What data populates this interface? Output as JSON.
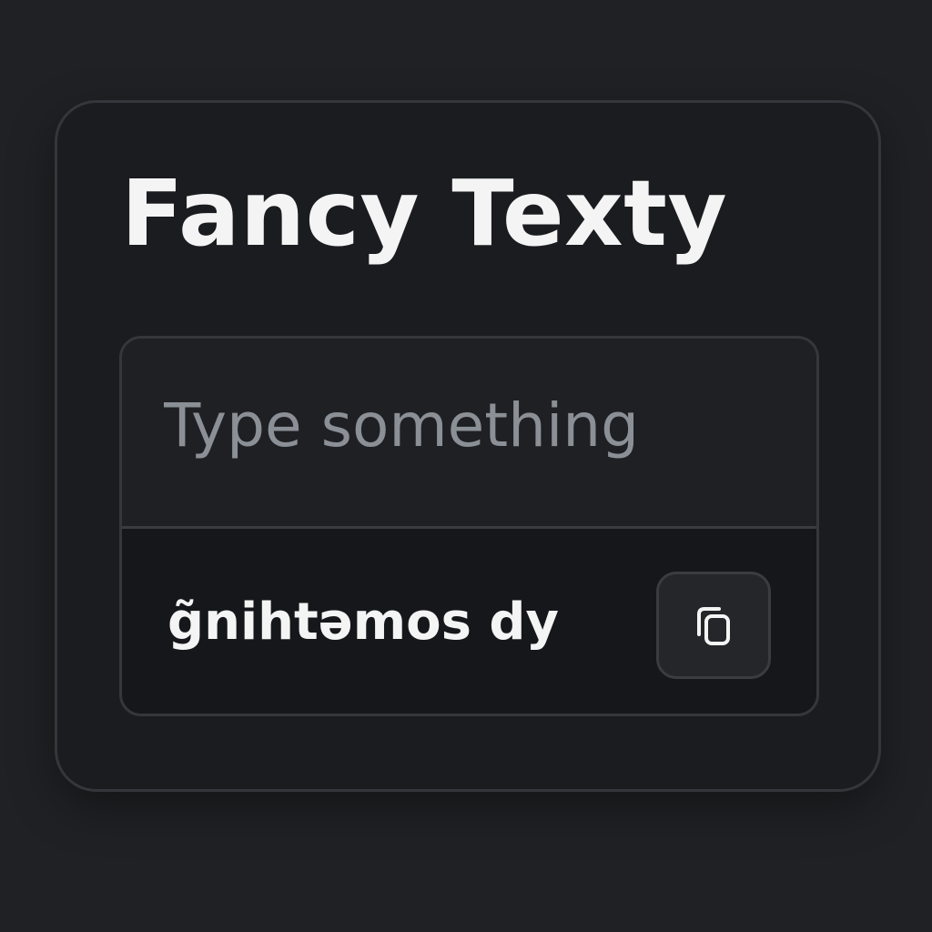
{
  "app": {
    "title": "Fancy Texty"
  },
  "input": {
    "value": "",
    "placeholder": "Type something"
  },
  "output": {
    "text": "g̃nihtəmos dy"
  },
  "copy_button": {
    "icon": "copy-icon"
  },
  "colors": {
    "background": "#202124",
    "card": "#1b1c1f",
    "output_background": "#16171a",
    "text": "#f4f4f5",
    "placeholder": "#8b8f96",
    "border": "#35373c"
  }
}
